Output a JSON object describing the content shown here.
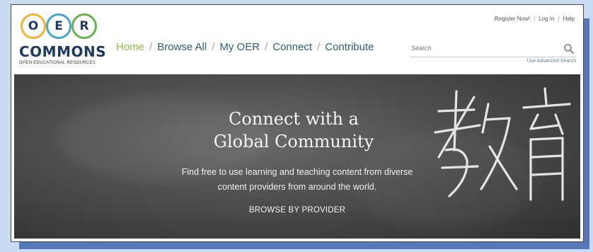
{
  "logo": {
    "letters": [
      "O",
      "E",
      "R"
    ],
    "wordmark": "COMMONS",
    "subtitle": "OPEN EDUCATIONAL RESOURCES"
  },
  "nav": {
    "items": [
      {
        "label": "Home",
        "active": true
      },
      {
        "label": "Browse All"
      },
      {
        "label": "My OER"
      },
      {
        "label": "Connect"
      },
      {
        "label": "Contribute"
      }
    ],
    "separator": "/"
  },
  "top_links": {
    "register": "Register Now!",
    "login": "Log In",
    "help": "Help",
    "separator": "|"
  },
  "search": {
    "placeholder": "Search",
    "icon": "search-icon",
    "advanced_link": "Use Advanced Search"
  },
  "hero": {
    "title_line1": "Connect with a",
    "title_line2": "Global Community",
    "text_line1": "Find free to use learning and teaching content from diverse",
    "text_line2": "content providers from around the world.",
    "cta": "BROWSE BY PROVIDER",
    "chalk_image": "chalk-chinese-characters"
  },
  "colors": {
    "nav_active": "#8cbf4b",
    "nav_link": "#2f5f7a",
    "brand_navy": "#1f3a5f",
    "circle_yellow": "#f2b233",
    "circle_blue": "#4aa3cf",
    "circle_green": "#6ab04c",
    "page_bg": "#c9dcf3",
    "frame_shadow": "#5577b8"
  }
}
